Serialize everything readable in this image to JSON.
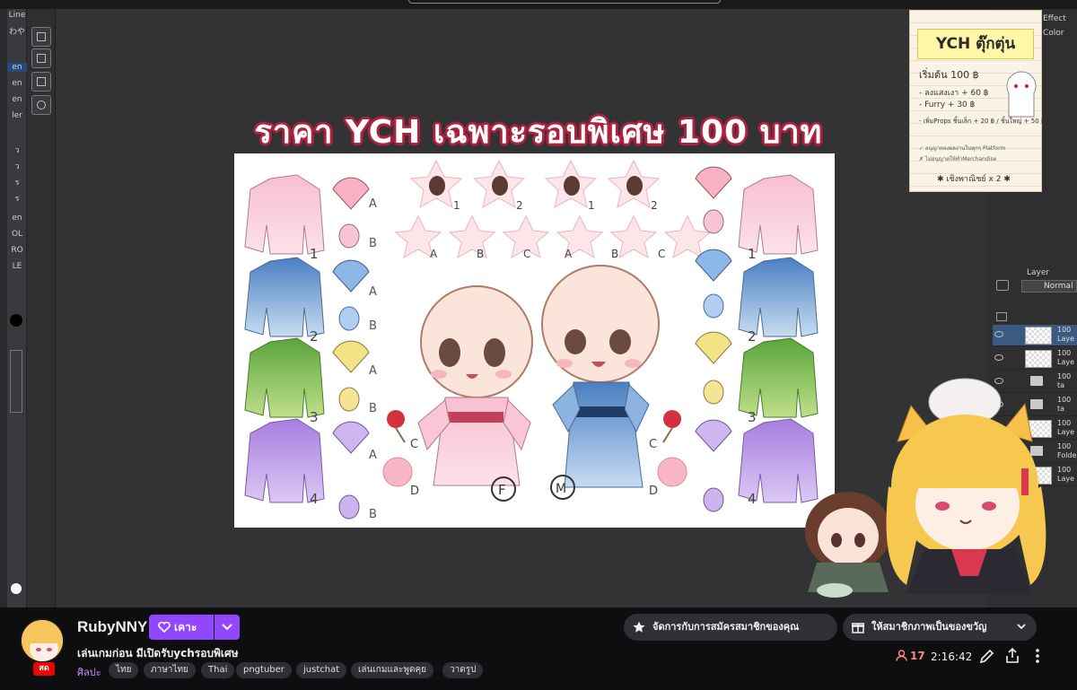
{
  "canvas": {
    "banner_text": "ราคา YCH เฉพาะรอบพิเศษ 100 บาท",
    "sheet_labels": {
      "letters_A": "A",
      "letters_B": "B",
      "letters_C": "C",
      "letters_D": "D",
      "num_1": "1",
      "num_2": "2",
      "num_3": "3",
      "num_4": "4",
      "female_mark": "F",
      "male_mark": "M"
    },
    "tool_labels": [
      "Line",
      "わや",
      "en",
      "en",
      "en",
      "ler",
      "ว",
      "ว",
      "ร",
      "ร",
      "en",
      "OL",
      "RO",
      "LE"
    ]
  },
  "price_card": {
    "title": "YCH ตุ๊กตุ่น",
    "lines": [
      "เริ่มต้น  100 ฿",
      "- ลงแสงเงา + 60 ฿",
      "- Furry + 30 ฿",
      "- เพิ่มProps ชิ้นเล็ก + 20 ฿ / ชิ้นใหญ่ + 50 ฿",
      "✓ อนุญาตลงผลงานในทุกๆ Platform",
      "✗ ไม่อนุญาตให้ทำMerchandise",
      "✱ เชิงพาณิชย์ x 2 ✱"
    ]
  },
  "layer_panel": {
    "tabs": [
      "Effect",
      "Color",
      "Layer"
    ],
    "blend_mode": "Normal",
    "layers": [
      {
        "opacity": "100",
        "name": "Laye",
        "type": "raster"
      },
      {
        "opacity": "100",
        "name": "Laye",
        "type": "raster"
      },
      {
        "opacity": "100",
        "name": "ta",
        "type": "folder"
      },
      {
        "opacity": "100",
        "name": "ta",
        "type": "folder"
      },
      {
        "opacity": "100",
        "name": "Laye",
        "type": "raster"
      },
      {
        "opacity": "100",
        "name": "Folde",
        "type": "folder"
      },
      {
        "opacity": "100",
        "name": "Laye",
        "type": "raster"
      }
    ]
  },
  "stream_info": {
    "channel_name": "RubyNNY",
    "follow_label": "เคาะ",
    "stream_title": "เล่นเกมก่อน มีเปิดรับychรอบพิเศษ",
    "category": "ศิลปะ",
    "tags": [
      "ไทย",
      "ภาษาไทย",
      "Thai",
      "pngtuber",
      "justchat",
      "เล่นเกมและพูดคุย",
      "วาดรูป"
    ],
    "live_badge": "สด",
    "manage_sub_label": "จัดการกับการสมัครสมาชิกของคุณ",
    "gift_sub_label": "ให้สมาชิกภาพเป็นของขวัญ",
    "viewer_count": "17",
    "uptime": "2:16:42"
  },
  "colors": {
    "twitch_purple": "#9147ff",
    "live_red": "#eb0400",
    "viewer_red": "#ff8280",
    "banner_outline": "#b0213e"
  },
  "icons": [
    "heart-follow-icon",
    "chevron-down-icon",
    "star-icon",
    "gift-icon",
    "viewer-person-icon",
    "pencil-icon",
    "share-icon",
    "more-vertical-icon"
  ]
}
